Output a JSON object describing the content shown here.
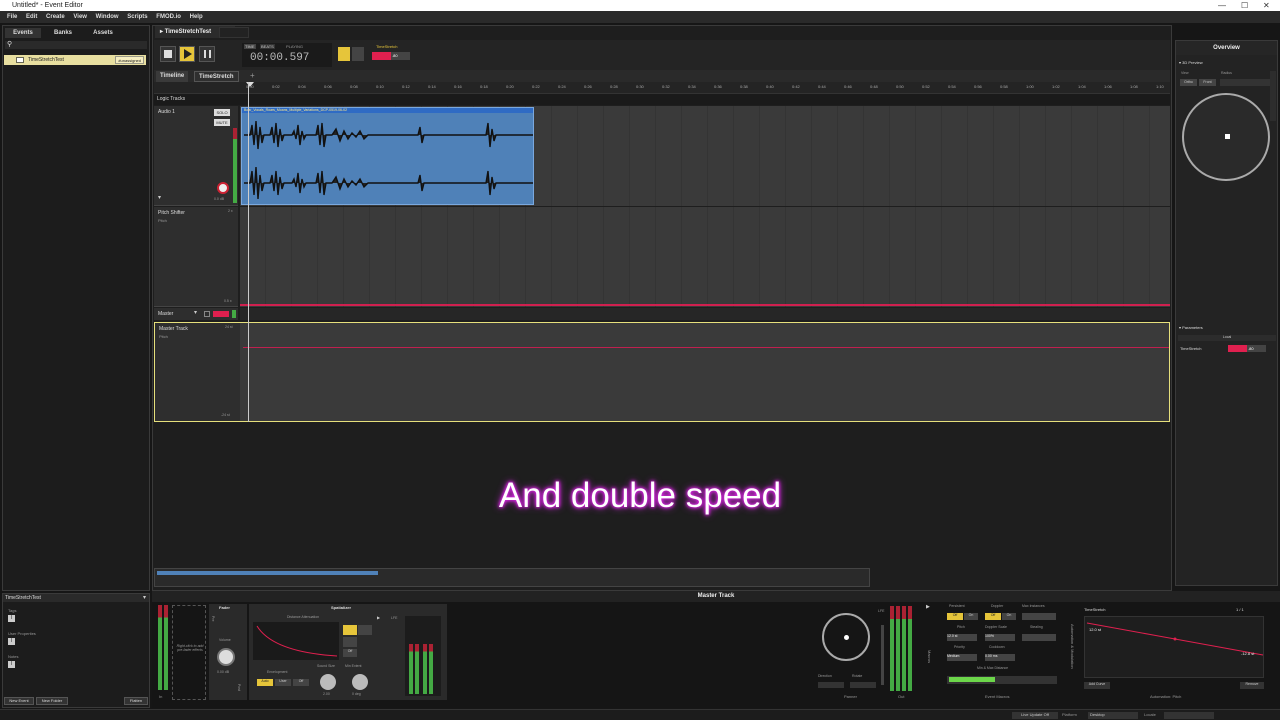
{
  "window": {
    "title": "Untitled* - Event Editor"
  },
  "menu": [
    "File",
    "Edit",
    "Create",
    "View",
    "Window",
    "Scripts",
    "FMOD.io",
    "Help"
  ],
  "browser": {
    "tabs": [
      "Events",
      "Banks",
      "Assets"
    ],
    "event_name": "TimeStretchTest",
    "event_badge": "#unassigned",
    "props_title": "TimeStretchTest",
    "props_tags": "Tags",
    "props_user": "User Properties",
    "props_notes": "Notes",
    "new_event": "New Event",
    "new_folder": "New Folder",
    "flatten": "Flatten"
  },
  "editor": {
    "tab": "TimeStretchTest",
    "time": "00:00.597",
    "time_labels": [
      "TIME",
      "BEATS",
      "PLAYING"
    ],
    "param_label": "TimeStretch",
    "param_value": ".80",
    "subtabs": [
      "Timeline",
      "TimeStretch"
    ],
    "logic_tracks": "Logic Tracks",
    "audio_track": "Audio 1",
    "solo": "SOLO",
    "mute": "MUTE",
    "vol_db": "0.0 dB",
    "clip_name": "Boar_Vocals_Roars_Moans_Multiple_Variations_DCP-0519-06-02",
    "pitch_shifter": "Pitch Shifter",
    "pitch": "Pitch",
    "pitch_top": "2 x",
    "pitch_bottom": "0.5 x",
    "master": "Master",
    "master_track": "Master Track",
    "mt_top": "24 st",
    "mt_bottom": "-24 st",
    "ruler": [
      "0:00",
      "0:02",
      "0:04",
      "0:06",
      "0:08",
      "0:10",
      "0:12",
      "0:14",
      "0:16",
      "0:18",
      "0:20",
      "0:22",
      "0:24",
      "0:26",
      "0:28",
      "0:30",
      "0:32",
      "0:34",
      "0:36",
      "0:38",
      "0:40",
      "0:42",
      "0:44",
      "0:46",
      "0:48",
      "0:50",
      "0:52",
      "0:54",
      "0:56",
      "0:58",
      "1:00",
      "1:02",
      "1:04",
      "1:06",
      "1:08",
      "1:10"
    ]
  },
  "caption": "And double speed",
  "overview": {
    "title": "Overview",
    "preview": "3D Preview",
    "view": "View",
    "radius": "Radius",
    "ortho": "Ortho",
    "front": "Front",
    "parameters": "Parameters",
    "local": "Local",
    "param": "TimeStretch",
    "param_value": ".80"
  },
  "deck": {
    "title": "Master Track",
    "fader": "Fader",
    "volume": "Volume",
    "vol_db": "0.00 dB",
    "pre": "Pre",
    "post": "Post",
    "hint": "Right-click to add pre-fader effects",
    "in": "In",
    "spatializer": "Spatializer",
    "dist_atten": "Distance Attenuation",
    "lfe": "LFE",
    "envelopment": "Envelopment",
    "auto": "Auto",
    "user": "User",
    "off": "Off",
    "sound_size": "Sound Size",
    "min_extent": "Min Extent",
    "sound_size_val": "2.00",
    "min_extent_val": "0 deg",
    "panner": "Panner",
    "out": "Out",
    "direction": "Direction",
    "rotate": "Rotate",
    "macros": "Macros",
    "persistent": "Persistent",
    "doppler": "Doppler",
    "max_instances": "Max Instances",
    "on": "On",
    "pitch": "Pitch",
    "doppler_scale": "Doppler Scale",
    "stealing": "Stealing",
    "pitch_val": "12.0 st",
    "doppler_val": "100%",
    "priority": "Priority",
    "cooldown": "Cooldown",
    "priority_val": "Medium",
    "cooldown_val": "0.00 ms",
    "minmax": "Min & Max Distance",
    "event_macros": "Event Macros",
    "auto_panel": "TimeStretch",
    "auto_side": "Automation & Modulation",
    "auto_top": "12.0 st",
    "auto_end": "-12.8 st",
    "add_curve": "Add Curve",
    "auto_pitch": "Automation: Pitch",
    "remove": "Remove",
    "page": "1 / 1"
  },
  "status": {
    "live_update": "Live Update Off",
    "platform_label": "Platform",
    "platform": "Desktop",
    "locale_label": "Locale"
  },
  "colors": {
    "accent": "#e6c53a",
    "clip": "#4f81b8",
    "param": "#e0204f"
  }
}
